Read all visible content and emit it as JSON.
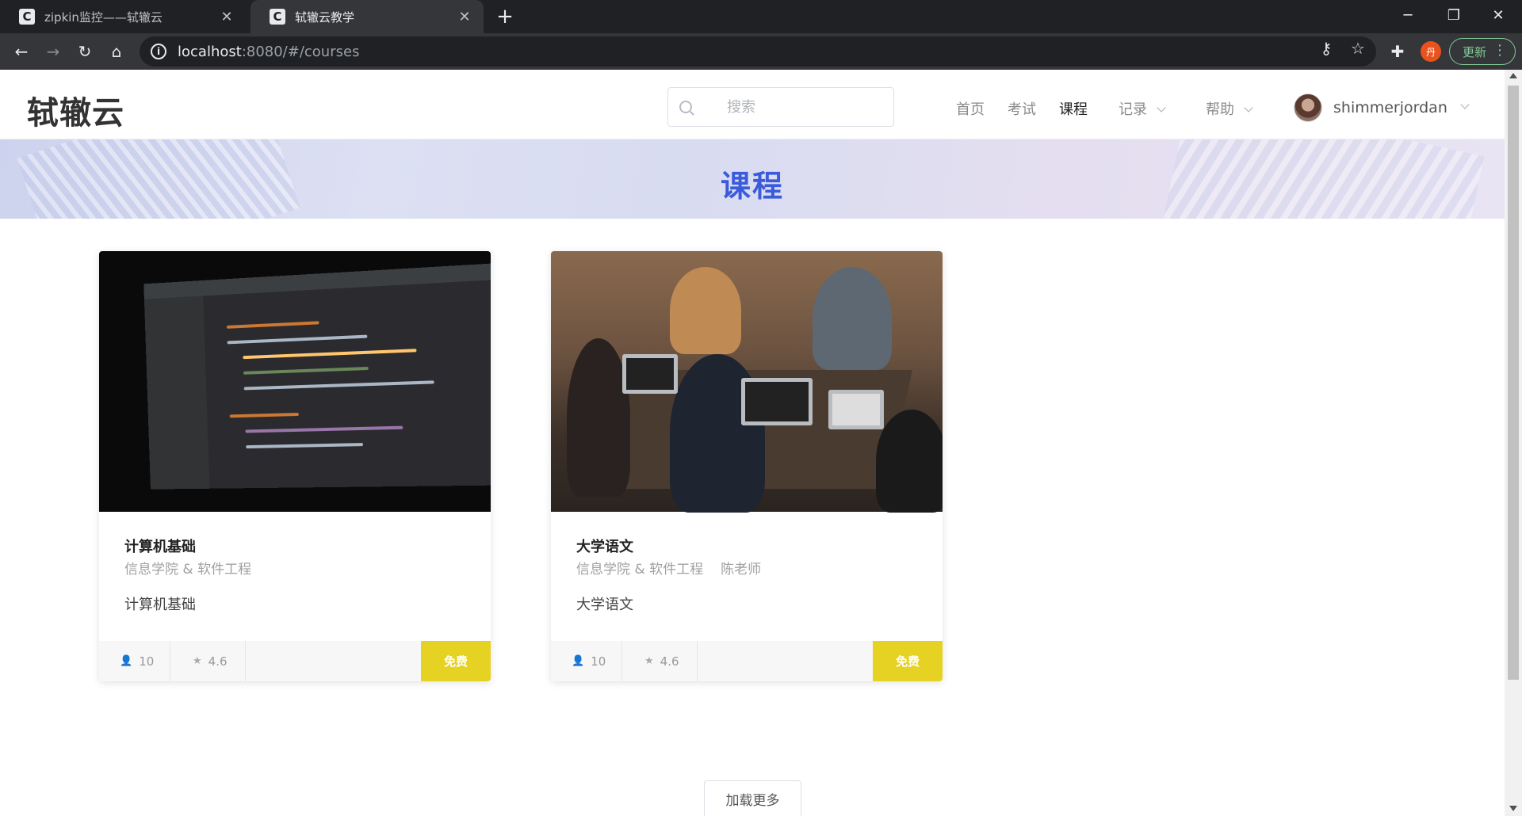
{
  "browser": {
    "tabs": [
      {
        "title": "zipkin监控——轼辙云",
        "favicon": "C"
      },
      {
        "title": "轼辙云教学",
        "favicon": "C"
      }
    ],
    "url_host": "localhost",
    "url_rest": ":8080/#/courses",
    "profile_badge": "丹",
    "update_label": "更新"
  },
  "header": {
    "logo": "轼辙云",
    "search_placeholder": "搜索",
    "nav": {
      "home": "首页",
      "exam": "考试",
      "courses": "课程",
      "records": "记录",
      "help": "帮助"
    },
    "username": "shimmerjordan"
  },
  "banner": {
    "title": "课程"
  },
  "courses": [
    {
      "name": "计算机基础",
      "department": "信息学院 & 软件工程",
      "teacher": "",
      "description": "计算机基础",
      "students": "10",
      "rating": "4.6",
      "price": "免费"
    },
    {
      "name": "大学语文",
      "department": "信息学院 & 软件工程",
      "teacher": "陈老师",
      "description": "大学语文",
      "students": "10",
      "rating": "4.6",
      "price": "免费"
    }
  ],
  "load_more_label": "加载更多",
  "colors": {
    "accent": "#3b5bdb",
    "price_badge": "#e5d223",
    "chrome_dark": "#202124"
  }
}
